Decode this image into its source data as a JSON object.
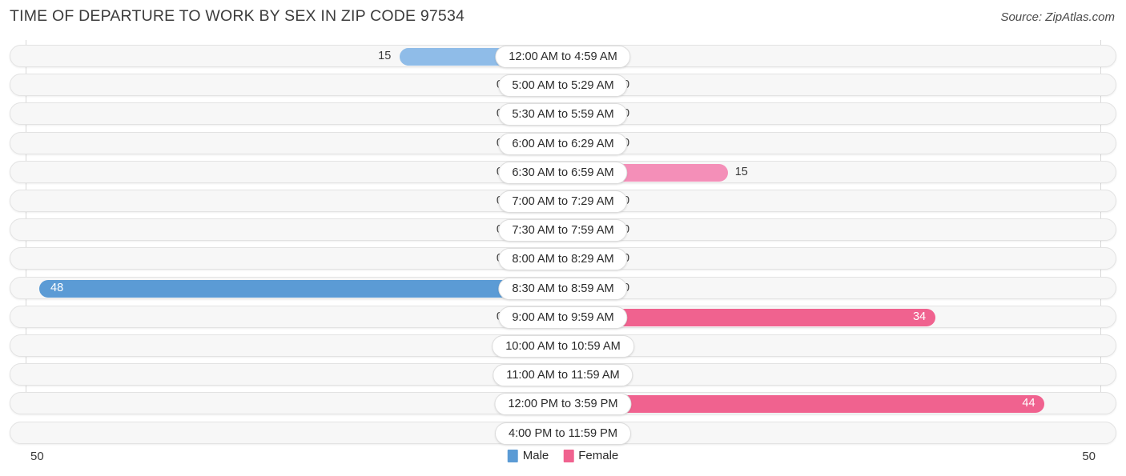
{
  "header": {
    "title": "TIME OF DEPARTURE TO WORK BY SEX IN ZIP CODE 97534",
    "source": "Source: ZipAtlas.com"
  },
  "legend": {
    "male_label": "Male",
    "female_label": "Female",
    "male_color": "#5b9bd5",
    "female_color": "#f0628f"
  },
  "axis": {
    "left_end": "50",
    "right_end": "50"
  },
  "chart_data": {
    "type": "bar",
    "orientation": "horizontal-diverging",
    "title": "TIME OF DEPARTURE TO WORK BY SEX IN ZIP CODE 97534",
    "xlabel": "",
    "ylabel": "",
    "xlim": [
      50,
      50
    ],
    "grid": false,
    "legend_position": "bottom-center",
    "categories": [
      "12:00 AM to 4:59 AM",
      "5:00 AM to 5:29 AM",
      "5:30 AM to 5:59 AM",
      "6:00 AM to 6:29 AM",
      "6:30 AM to 6:59 AM",
      "7:00 AM to 7:29 AM",
      "7:30 AM to 7:59 AM",
      "8:00 AM to 8:29 AM",
      "8:30 AM to 8:59 AM",
      "9:00 AM to 9:59 AM",
      "10:00 AM to 10:59 AM",
      "11:00 AM to 11:59 AM",
      "12:00 PM to 3:59 PM",
      "4:00 PM to 11:59 PM"
    ],
    "series": [
      {
        "name": "Male",
        "values": [
          15,
          0,
          0,
          0,
          0,
          0,
          0,
          0,
          48,
          0,
          0,
          0,
          0,
          0
        ]
      },
      {
        "name": "Female",
        "values": [
          0,
          0,
          0,
          0,
          15,
          0,
          0,
          0,
          0,
          34,
          0,
          0,
          44,
          0
        ]
      }
    ]
  },
  "rows": [
    {
      "label": "12:00 AM to 4:59 AM",
      "male": "15",
      "female": "0"
    },
    {
      "label": "5:00 AM to 5:29 AM",
      "male": "0",
      "female": "0"
    },
    {
      "label": "5:30 AM to 5:59 AM",
      "male": "0",
      "female": "0"
    },
    {
      "label": "6:00 AM to 6:29 AM",
      "male": "0",
      "female": "0"
    },
    {
      "label": "6:30 AM to 6:59 AM",
      "male": "0",
      "female": "15"
    },
    {
      "label": "7:00 AM to 7:29 AM",
      "male": "0",
      "female": "0"
    },
    {
      "label": "7:30 AM to 7:59 AM",
      "male": "0",
      "female": "0"
    },
    {
      "label": "8:00 AM to 8:29 AM",
      "male": "0",
      "female": "0"
    },
    {
      "label": "8:30 AM to 8:59 AM",
      "male": "48",
      "female": "0"
    },
    {
      "label": "9:00 AM to 9:59 AM",
      "male": "0",
      "female": "34"
    },
    {
      "label": "10:00 AM to 10:59 AM",
      "male": "0",
      "female": "0"
    },
    {
      "label": "11:00 AM to 11:59 AM",
      "male": "0",
      "female": "0"
    },
    {
      "label": "12:00 PM to 3:59 PM",
      "male": "0",
      "female": "44"
    },
    {
      "label": "4:00 PM to 11:59 PM",
      "male": "0",
      "female": "0"
    }
  ]
}
